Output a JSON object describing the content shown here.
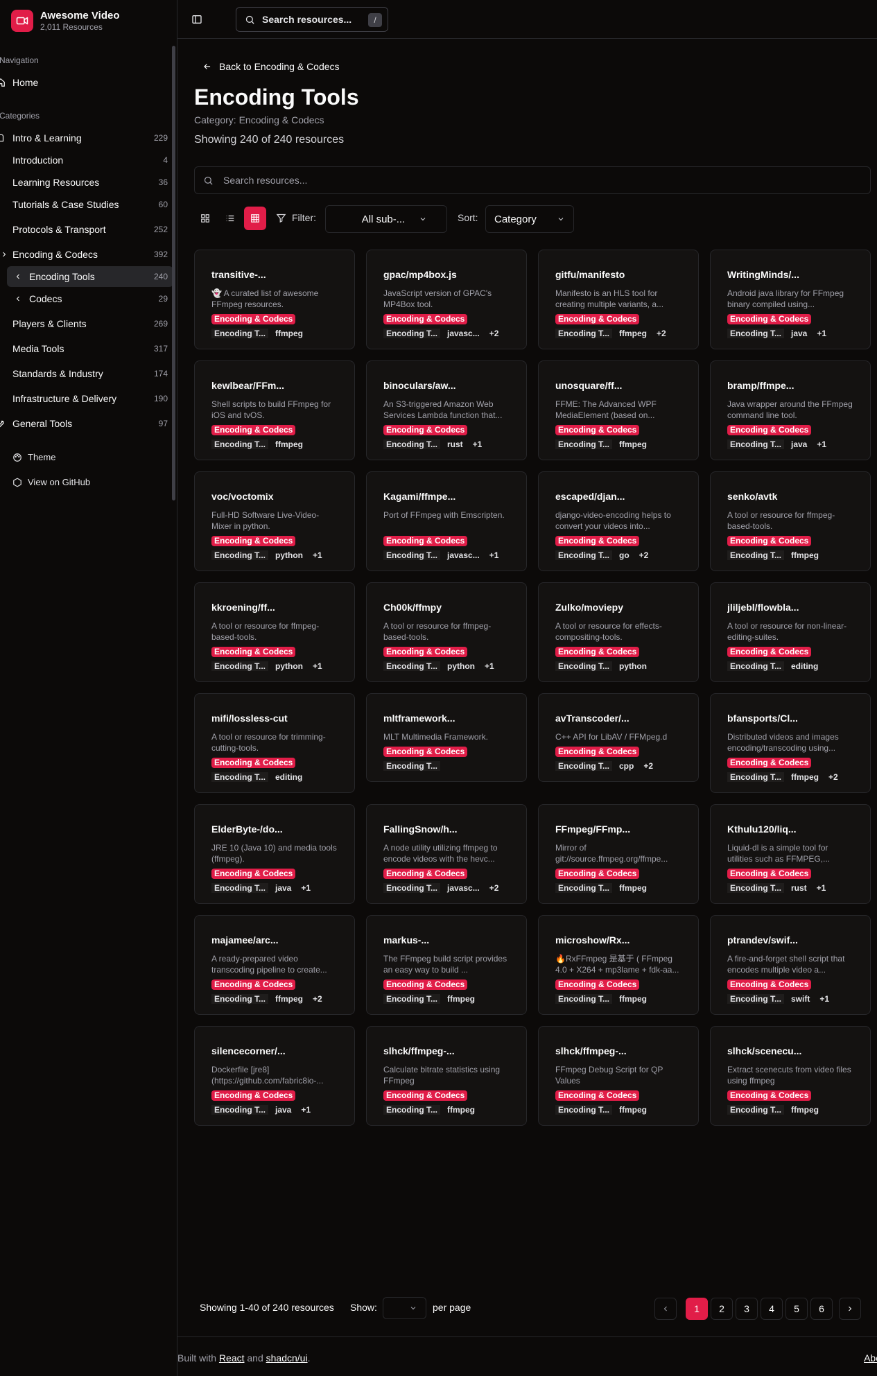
{
  "brand": {
    "title": "Awesome Video",
    "subtitle": "2,011 Resources"
  },
  "sidebar": {
    "nav_label": "Navigation",
    "home": "Home",
    "categories_label": "Categories",
    "items": [
      {
        "label": "Intro & Learning",
        "count": "229"
      },
      {
        "label": "Introduction",
        "count": "4"
      },
      {
        "label": "Learning Resources",
        "count": "36"
      },
      {
        "label": "Tutorials & Case Studies",
        "count": "60"
      },
      {
        "label": "Protocols & Transport",
        "count": "252"
      },
      {
        "label": "Encoding & Codecs",
        "count": "392"
      },
      {
        "label": "Encoding Tools",
        "count": "240"
      },
      {
        "label": "Codecs",
        "count": "29"
      },
      {
        "label": "Players & Clients",
        "count": "269"
      },
      {
        "label": "Media Tools",
        "count": "317"
      },
      {
        "label": "Standards & Industry",
        "count": "174"
      },
      {
        "label": "Infrastructure & Delivery",
        "count": "190"
      },
      {
        "label": "General Tools",
        "count": "97"
      }
    ],
    "theme": "Theme",
    "github": "View on GitHub"
  },
  "header": {
    "search_placeholder": "Search resources...",
    "shortcut": "/"
  },
  "main": {
    "back": "Back to Encoding & Codecs",
    "title": "Encoding Tools",
    "category": "Category: Encoding & Codecs",
    "showing": "Showing 240 of 240 resources",
    "search_placeholder": "Search resources...",
    "filter_label": "Filter:",
    "filter_value": "All sub-...",
    "sort_label": "Sort:",
    "sort_value": "Category"
  },
  "cards": [
    {
      "title": "transitive-...",
      "desc": "👻 A curated list of awesome FFmpeg resources.",
      "cat": "Encoding & Codecs",
      "tags": [
        "Encoding T...",
        "ffmpeg"
      ]
    },
    {
      "title": "gpac/mp4box.js",
      "desc": "JavaScript version of GPAC's MP4Box tool.",
      "cat": "Encoding & Codecs",
      "tags": [
        "Encoding T...",
        "javasc...",
        "+2"
      ]
    },
    {
      "title": "gitfu/manifesto",
      "desc": "Manifesto is an HLS tool for creating multiple variants, a...",
      "cat": "Encoding & Codecs",
      "tags": [
        "Encoding T...",
        "ffmpeg",
        "+2"
      ]
    },
    {
      "title": "WritingMinds/...",
      "desc": "Android java library for FFmpeg binary compiled using...",
      "cat": "Encoding & Codecs",
      "tags": [
        "Encoding T...",
        "java",
        "+1"
      ]
    },
    {
      "title": "kewlbear/FFm...",
      "desc": "Shell scripts to build FFmpeg for iOS and tvOS.",
      "cat": "Encoding & Codecs",
      "tags": [
        "Encoding T...",
        "ffmpeg"
      ]
    },
    {
      "title": "binoculars/aw...",
      "desc": "An S3-triggered Amazon Web Services Lambda function that...",
      "cat": "Encoding & Codecs",
      "tags": [
        "Encoding T...",
        "rust",
        "+1"
      ]
    },
    {
      "title": "unosquare/ff...",
      "desc": "FFME: The Advanced WPF MediaElement (based on...",
      "cat": "Encoding & Codecs",
      "tags": [
        "Encoding T...",
        "ffmpeg"
      ]
    },
    {
      "title": "bramp/ffmpe...",
      "desc": "Java wrapper around the FFmpeg command line tool.",
      "cat": "Encoding & Codecs",
      "tags": [
        "Encoding T...",
        "java",
        "+1"
      ]
    },
    {
      "title": "voc/voctomix",
      "desc": "Full-HD Software Live-Video-Mixer in python.",
      "cat": "Encoding & Codecs",
      "tags": [
        "Encoding T...",
        "python",
        "+1"
      ]
    },
    {
      "title": "Kagami/ffmpe...",
      "desc": "Port of FFmpeg with Emscripten.",
      "cat": "Encoding & Codecs",
      "tags": [
        "Encoding T...",
        "javasc...",
        "+1"
      ]
    },
    {
      "title": "escaped/djan...",
      "desc": "django-video-encoding helps to convert your videos into...",
      "cat": "Encoding & Codecs",
      "tags": [
        "Encoding T...",
        "go",
        "+2"
      ]
    },
    {
      "title": "senko/avtk",
      "desc": "A tool or resource for ffmpeg-based-tools.",
      "cat": "Encoding & Codecs",
      "tags": [
        "Encoding T...",
        "ffmpeg"
      ]
    },
    {
      "title": "kkroening/ff...",
      "desc": "A tool or resource for ffmpeg-based-tools.",
      "cat": "Encoding & Codecs",
      "tags": [
        "Encoding T...",
        "python",
        "+1"
      ]
    },
    {
      "title": "Ch00k/ffmpy",
      "desc": "A tool or resource for ffmpeg-based-tools.",
      "cat": "Encoding & Codecs",
      "tags": [
        "Encoding T...",
        "python",
        "+1"
      ]
    },
    {
      "title": "Zulko/moviepy",
      "desc": "A tool or resource for effects-compositing-tools.",
      "cat": "Encoding & Codecs",
      "tags": [
        "Encoding T...",
        "python"
      ]
    },
    {
      "title": "jliljebl/flowbla...",
      "desc": "A tool or resource for non-linear-editing-suites.",
      "cat": "Encoding & Codecs",
      "tags": [
        "Encoding T...",
        "editing"
      ]
    },
    {
      "title": "mifi/lossless-cut",
      "desc": "A tool or resource for trimming-cutting-tools.",
      "cat": "Encoding & Codecs",
      "tags": [
        "Encoding T...",
        "editing"
      ]
    },
    {
      "title": "mltframework...",
      "desc": "MLT Multimedia Framework.",
      "cat": "Encoding & Codecs",
      "tags": [
        "Encoding T..."
      ]
    },
    {
      "title": "avTranscoder/...",
      "desc": "C++ API for LibAV / FFMpeg.d",
      "cat": "Encoding & Codecs",
      "tags": [
        "Encoding T...",
        "cpp",
        "+2"
      ]
    },
    {
      "title": "bfansports/Cl...",
      "desc": "Distributed videos and images encoding/transcoding using...",
      "cat": "Encoding & Codecs",
      "tags": [
        "Encoding T...",
        "ffmpeg",
        "+2"
      ]
    },
    {
      "title": "ElderByte-/do...",
      "desc": "JRE 10 (Java 10) and media tools (ffmpeg).",
      "cat": "Encoding & Codecs",
      "tags": [
        "Encoding T...",
        "java",
        "+1"
      ]
    },
    {
      "title": "FallingSnow/h...",
      "desc": "A node utility utilizing ffmpeg to encode videos with the hevc...",
      "cat": "Encoding & Codecs",
      "tags": [
        "Encoding T...",
        "javasc...",
        "+2"
      ]
    },
    {
      "title": "FFmpeg/FFmp...",
      "desc": "Mirror of git://source.ffmpeg.org/ffmpe...",
      "cat": "Encoding & Codecs",
      "tags": [
        "Encoding T...",
        "ffmpeg"
      ]
    },
    {
      "title": "Kthulu120/liq...",
      "desc": "Liquid-dl is a simple tool for utilities such as FFMPEG,...",
      "cat": "Encoding & Codecs",
      "tags": [
        "Encoding T...",
        "rust",
        "+1"
      ]
    },
    {
      "title": "majamee/arc...",
      "desc": "A ready-prepared video transcoding pipeline to create...",
      "cat": "Encoding & Codecs",
      "tags": [
        "Encoding T...",
        "ffmpeg",
        "+2"
      ]
    },
    {
      "title": "markus-...",
      "desc": "The FFmpeg build script provides an easy way to build ...",
      "cat": "Encoding & Codecs",
      "tags": [
        "Encoding T...",
        "ffmpeg"
      ]
    },
    {
      "title": "microshow/Rx...",
      "desc": "🔥RxFFmpeg 是基于 ( FFmpeg 4.0 + X264 + mp3lame + fdk-aa...",
      "cat": "Encoding & Codecs",
      "tags": [
        "Encoding T...",
        "ffmpeg"
      ]
    },
    {
      "title": "ptrandev/swif...",
      "desc": "A fire-and-forget shell script that encodes multiple video a...",
      "cat": "Encoding & Codecs",
      "tags": [
        "Encoding T...",
        "swift",
        "+1"
      ]
    },
    {
      "title": "silencecorner/...",
      "desc": "Dockerfile [jre8] (https://github.com/fabric8io-...",
      "cat": "Encoding & Codecs",
      "tags": [
        "Encoding T...",
        "java",
        "+1"
      ]
    },
    {
      "title": "slhck/ffmpeg-...",
      "desc": "Calculate bitrate statistics using FFmpeg",
      "cat": "Encoding & Codecs",
      "tags": [
        "Encoding T...",
        "ffmpeg"
      ]
    },
    {
      "title": "slhck/ffmpeg-...",
      "desc": "FFmpeg Debug Script for QP Values",
      "cat": "Encoding & Codecs",
      "tags": [
        "Encoding T...",
        "ffmpeg"
      ]
    },
    {
      "title": "slhck/scenecu...",
      "desc": "Extract scenecuts from video files using ffmpeg",
      "cat": "Encoding & Codecs",
      "tags": [
        "Encoding T...",
        "ffmpeg"
      ]
    }
  ],
  "pagination": {
    "showing": "Showing 1-40 of 240 resources",
    "show_label": "Show:",
    "per_page": "per page",
    "pages": [
      "1",
      "2",
      "3",
      "4",
      "5",
      "6"
    ],
    "current": "1"
  },
  "footer": {
    "built": "Built with",
    "react": "React",
    "and": "and",
    "shadcn": "shadcn/ui",
    "period": ".",
    "about": "Abo"
  },
  "colors": {
    "accent": "#e11d48",
    "background": "#0c0a09",
    "border": "#27272a"
  }
}
